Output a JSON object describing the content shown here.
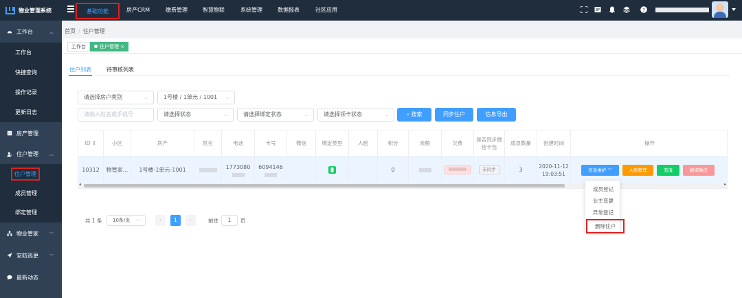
{
  "app": {
    "title": "物业管理系统"
  },
  "topnav": [
    {
      "label": "基础功能",
      "active": true
    },
    {
      "label": "房产CRM"
    },
    {
      "label": "缴费管理"
    },
    {
      "label": "智慧物联"
    },
    {
      "label": "系统管理"
    },
    {
      "label": "数据报表"
    },
    {
      "label": "社区应用"
    }
  ],
  "top_icons": [
    "fullscreen-icon",
    "message-icon",
    "bell-icon",
    "layers-icon",
    "help-icon"
  ],
  "sidebar": {
    "items": [
      {
        "label": "工作台",
        "icon": "dashboard-icon",
        "expanded": true
      },
      {
        "label": "工作台",
        "sub": true
      },
      {
        "label": "快捷查询",
        "sub": true
      },
      {
        "label": "操作记录",
        "sub": true
      },
      {
        "label": "更新日志",
        "sub": true
      },
      {
        "label": "房产管理",
        "icon": "building-icon"
      },
      {
        "label": "住户管理",
        "icon": "users-icon",
        "expanded": true
      },
      {
        "label": "住户管理",
        "sub": true,
        "active": true
      },
      {
        "label": "成员管理",
        "sub": true
      },
      {
        "label": "绑定管理",
        "sub": true
      },
      {
        "label": "物业管家",
        "icon": "org-icon"
      },
      {
        "label": "安防巡更",
        "icon": "send-icon"
      },
      {
        "label": "最新动态",
        "icon": "chat-icon"
      }
    ]
  },
  "breadcrumb": {
    "home": "首页",
    "separator": "/",
    "current": "住户管理"
  },
  "tags": {
    "workbench": "工作台",
    "current": "住户管理",
    "close": "×"
  },
  "tabs": {
    "list": "住户列表",
    "pending": "待审核列表"
  },
  "filters": {
    "house_type": "请选择房户类别",
    "building": "1号楼 / 1单元 / 1001",
    "name_phone_placeholder": "请输入姓名或手机号",
    "status": "请选择状态",
    "bind_status": "请选择绑定状态",
    "card_status": "请选择领卡状态"
  },
  "buttons": {
    "search": "搜索",
    "sync": "同步住户",
    "export": "信息导出"
  },
  "table": {
    "columns": [
      "ID",
      "小区",
      "房产",
      "姓名",
      "电话",
      "卡号",
      "微信",
      "绑定类型",
      "人脸",
      "积分",
      "余额",
      "欠费",
      "是否同步微信卡包",
      "成员数量",
      "创建时间",
      "操作"
    ],
    "row": {
      "id": "10312",
      "community": "物管家...",
      "property": "1号楼-1单元-1001",
      "phone": "1773080",
      "card": "6094146",
      "points": "0",
      "sync": "未同步",
      "members": "3",
      "created_date": "2020-11-12",
      "created_time": "19:03:51"
    },
    "actions": {
      "info": "信息维护",
      "face": "人脸管理",
      "recharge": "充值",
      "unbind": "解绑微信"
    }
  },
  "dropdown": [
    "成员登记",
    "业主变更",
    "异常登记",
    "删除住户"
  ],
  "pagination": {
    "total": "共 1 条",
    "page_size": "10条/页",
    "current": "1",
    "goto": "前往",
    "goto_value": "1",
    "page_unit": "页"
  },
  "colors": {
    "primary": "#409eff",
    "sidebar": "#304156",
    "topbar": "#1f2d3d",
    "success": "#13ce66",
    "warning": "#ff9900",
    "danger_light": "#f89898",
    "highlight": "#e02020"
  }
}
